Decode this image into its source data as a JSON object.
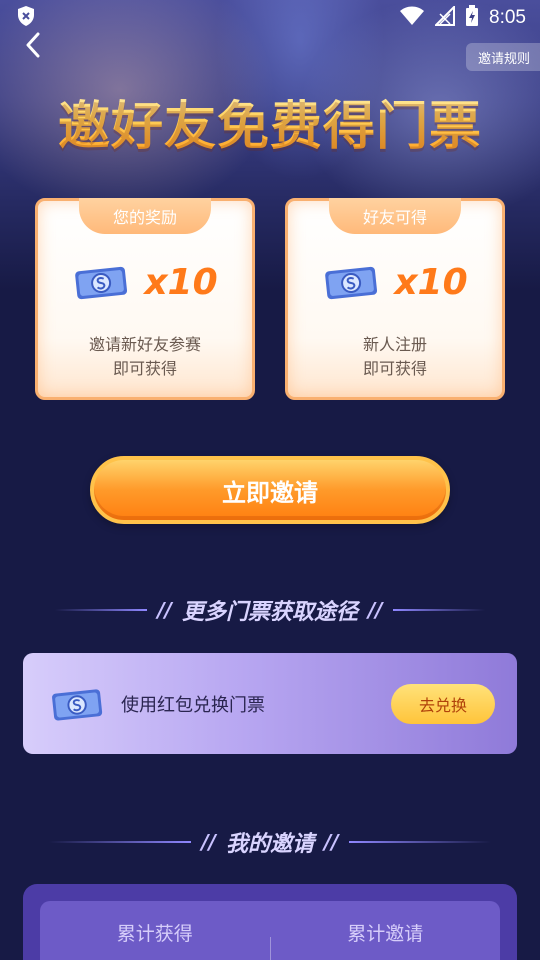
{
  "status_bar": {
    "time": "8:05"
  },
  "header": {
    "rules_label": "邀请规则",
    "title": "邀好友免费得门票"
  },
  "cards": [
    {
      "tab": "您的奖励",
      "count": "x10",
      "desc_line1": "邀请新好友参赛",
      "desc_line2": "即可获得"
    },
    {
      "tab": "好友可得",
      "count": "x10",
      "desc_line1": "新人注册",
      "desc_line2": "即可获得"
    }
  ],
  "invite_button": "立即邀请",
  "more_section": {
    "slashes": "//",
    "title": "更多门票获取途径",
    "exchange_text": "使用红包兑换门票",
    "exchange_button": "去兑换"
  },
  "my_invites": {
    "slashes": "//",
    "title": "我的邀请",
    "stats": [
      "累计获得",
      "累计邀请"
    ]
  },
  "colors": {
    "accent": "#ff7f10",
    "background": "#171a45",
    "card_border": "#f9b070"
  },
  "icons": [
    "shield-icon",
    "wifi-icon",
    "signal-icon",
    "battery-icon",
    "back-icon",
    "ticket-icon"
  ]
}
